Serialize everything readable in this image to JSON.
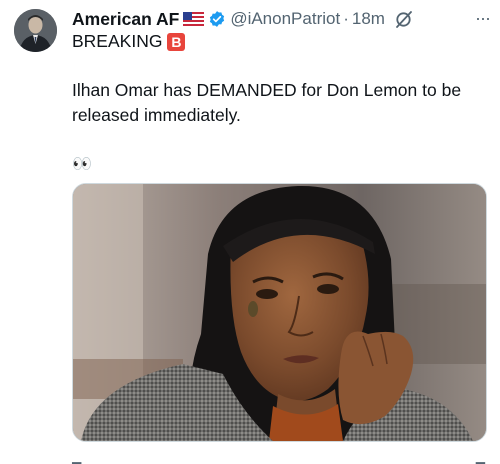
{
  "tweet": {
    "display_name": "American AF",
    "handle": "@iAnonPatriot",
    "separator": "·",
    "time": "18m",
    "more_label": "···",
    "line1": "BREAKING",
    "badge_letter": "B",
    "body": "Ilhan Omar has DEMANDED for Don Lemon to be released immediately.",
    "eyes": "👀"
  },
  "icons": {
    "flag": "us-flag-icon",
    "verified": "verified-badge-icon",
    "grok": "grok-icon",
    "badge": "b-button-icon"
  },
  "colors": {
    "verified": "#1d9bf0",
    "secondary_text": "#536471",
    "badge": "#e8453c"
  }
}
